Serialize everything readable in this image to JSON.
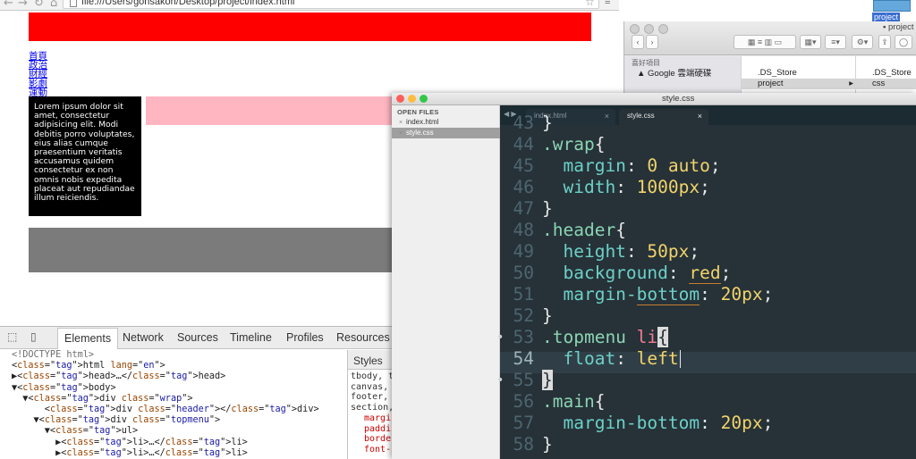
{
  "browser": {
    "url": "file:///Users/gonsakon/Desktop/project/index.html",
    "menu_items": [
      "首頁",
      "政治",
      "財經",
      "影劇",
      "運動"
    ],
    "lorem": "Lorem ipsum dolor sit amet, consectetur adipisicing elit. Modi debitis porro voluptates, eius alias cumque praesentium veritatis accusamus quidem consectetur ex non omnis nobis expedita placeat aut repudiandae illum reiciendis.",
    "colors": {
      "header": "#ff0000",
      "sidebar": "#000000",
      "pink": "#ffb6c1",
      "footer": "#7b7b7b"
    }
  },
  "devtools": {
    "tabs": [
      "Elements",
      "Network",
      "Sources",
      "Timeline",
      "Profiles",
      "Resources"
    ],
    "active_tab": "Elements",
    "dom_lines": [
      {
        "text": "<!DOCTYPE html>",
        "kind": "comment"
      },
      {
        "text": "<html lang=\"en\">"
      },
      {
        "text": "▶<head>…</head>"
      },
      {
        "text": "▼<body>"
      },
      {
        "text": "  ▼<div class=\"wrap\">"
      },
      {
        "text": "      <div class=\"header\"></div>"
      },
      {
        "text": "    ▼<div class=\"topmenu\">"
      },
      {
        "text": "      ▼<ul>"
      },
      {
        "text": "        ▶<li>…</li>"
      },
      {
        "text": "        ▶<li>…</li>"
      }
    ],
    "styles_tab": "Styles",
    "styles_lines": [
      "tbody, t",
      "canvas,",
      "footer,",
      "section,"
    ],
    "styles_props": [
      "margi",
      "paddi",
      "borde",
      "font-"
    ]
  },
  "finder": {
    "title": "project",
    "favorites_heading": "喜好項目",
    "sidebar_item": "Google 雲端硬碟",
    "col1": [
      ".DS_Store",
      "project"
    ],
    "col2": [
      ".DS_Store",
      "css"
    ],
    "pathbar": "project",
    "desktop_folder": "project"
  },
  "sublime": {
    "title": "style.css",
    "open_files_heading": "OPEN FILES",
    "open_files": [
      "index.html",
      "style.css"
    ],
    "selected_file": "style.css",
    "tabs": [
      {
        "label": "index.html",
        "active": false
      },
      {
        "label": "style.css",
        "active": true
      }
    ],
    "tab_nav": "◀ ▶",
    "line_numbers": [
      "43",
      "44",
      "45",
      "46",
      "47",
      "48",
      "49",
      "50",
      "51",
      "52",
      "53",
      "54",
      "55",
      "56",
      "57",
      "58"
    ],
    "code_lines": [
      "}",
      ".wrap{",
      "  margin: 0 auto;",
      "  width: 1000px;",
      "}",
      ".header{",
      "  height: 50px;",
      "  background: red;",
      "  margin-bottom: 20px;",
      "}",
      ".topmenu li{",
      "  float: left",
      "}",
      ".main{",
      "  margin-bottom: 20px;",
      "}"
    ],
    "current_line": "54",
    "colors": {
      "editor_bg": "#263238",
      "selector": "#8bd4b3",
      "property": "#6dd0c8",
      "value": "#f2d36b",
      "element": "#f27b92"
    }
  }
}
